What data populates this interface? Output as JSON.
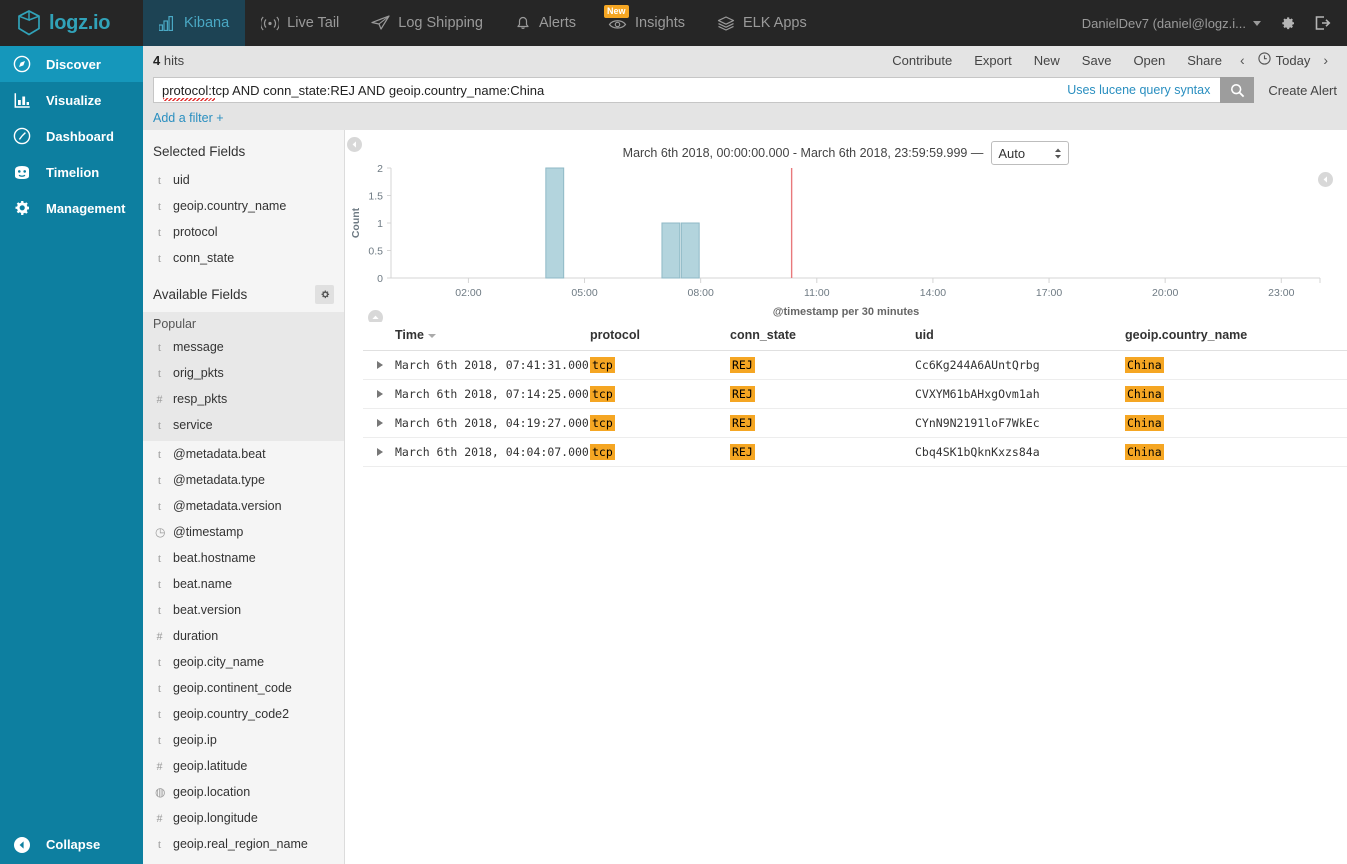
{
  "brand": {
    "name": "logz.io"
  },
  "topnav": {
    "items": [
      {
        "label": "Kibana",
        "icon": "bar-chart-icon",
        "active": true
      },
      {
        "label": "Live Tail",
        "icon": "broadcast-icon",
        "active": false
      },
      {
        "label": "Log Shipping",
        "icon": "paper-plane-icon",
        "active": false
      },
      {
        "label": "Alerts",
        "icon": "bell-icon",
        "active": false
      },
      {
        "label": "Insights",
        "icon": "eye-icon",
        "active": false,
        "badge": "New"
      },
      {
        "label": "ELK Apps",
        "icon": "layers-icon",
        "active": false
      }
    ],
    "user": "DanielDev7 (daniel@logz.i...",
    "settings_icon": "gear-icon",
    "logout_icon": "logout-icon"
  },
  "leftnav": {
    "items": [
      {
        "label": "Discover",
        "icon": "compass-icon",
        "active": true
      },
      {
        "label": "Visualize",
        "icon": "bar-chart-icon",
        "active": false
      },
      {
        "label": "Dashboard",
        "icon": "dashboard-icon",
        "active": false
      },
      {
        "label": "Timelion",
        "icon": "timelion-icon",
        "active": false
      },
      {
        "label": "Management",
        "icon": "gear-icon",
        "active": false
      }
    ],
    "collapse_label": "Collapse"
  },
  "toolbar": {
    "hits_count": "4",
    "hits_label": "hits",
    "links": [
      "Contribute",
      "Export",
      "New",
      "Save",
      "Open",
      "Share"
    ],
    "prev_arrow": "‹",
    "next_arrow": "›",
    "time_label": "Today",
    "clock_icon": "clock-icon"
  },
  "search": {
    "query": "protocol:tcp AND conn_state:REJ AND geoip.country_name:China",
    "hint": "Uses lucene query syntax",
    "search_icon": "search-icon",
    "create_alert": "Create Alert",
    "add_filter": "Add a filter +"
  },
  "fields": {
    "selected_title": "Selected Fields",
    "selected": [
      {
        "type": "t",
        "name": "uid"
      },
      {
        "type": "t",
        "name": "geoip.country_name"
      },
      {
        "type": "t",
        "name": "protocol"
      },
      {
        "type": "t",
        "name": "conn_state"
      }
    ],
    "available_title": "Available Fields",
    "settings_icon": "gear-icon",
    "popular_title": "Popular",
    "popular": [
      {
        "type": "t",
        "name": "message"
      },
      {
        "type": "t",
        "name": "orig_pkts"
      },
      {
        "type": "#",
        "name": "resp_pkts"
      },
      {
        "type": "t",
        "name": "service"
      }
    ],
    "available": [
      {
        "type": "t",
        "name": "@metadata.beat"
      },
      {
        "type": "t",
        "name": "@metadata.type"
      },
      {
        "type": "t",
        "name": "@metadata.version"
      },
      {
        "type": "◷",
        "name": "@timestamp"
      },
      {
        "type": "t",
        "name": "beat.hostname"
      },
      {
        "type": "t",
        "name": "beat.name"
      },
      {
        "type": "t",
        "name": "beat.version"
      },
      {
        "type": "#",
        "name": "duration"
      },
      {
        "type": "t",
        "name": "geoip.city_name"
      },
      {
        "type": "t",
        "name": "geoip.continent_code"
      },
      {
        "type": "t",
        "name": "geoip.country_code2"
      },
      {
        "type": "t",
        "name": "geoip.ip"
      },
      {
        "type": "#",
        "name": "geoip.latitude"
      },
      {
        "type": "◍",
        "name": "geoip.location"
      },
      {
        "type": "#",
        "name": "geoip.longitude"
      },
      {
        "type": "t",
        "name": "geoip.real_region_name"
      }
    ]
  },
  "chart_header": {
    "range": "March 6th 2018, 00:00:00.000 - March 6th 2018, 23:59:59.999 —",
    "interval": "Auto"
  },
  "chart_data": {
    "type": "bar",
    "title": "",
    "xlabel": "@timestamp per 30 minutes",
    "ylabel": "Count",
    "ylim": [
      0,
      2
    ],
    "yticks": [
      0,
      0.5,
      1,
      1.5,
      2
    ],
    "ytick_labels": [
      "0",
      "0.5",
      "1",
      "1.5",
      "2"
    ],
    "xtick_labels": [
      "02:00",
      "05:00",
      "08:00",
      "11:00",
      "14:00",
      "17:00",
      "20:00",
      "23:00"
    ],
    "xtick_hours": [
      2,
      5,
      8,
      11,
      14,
      17,
      20,
      23
    ],
    "x_domain_hours": [
      0,
      24
    ],
    "grid": false,
    "bar_color": "#b3d4dd",
    "bar_border_color": "#8fb9c6",
    "marker_color": "#e8797b",
    "marker_hour": 10.35,
    "bars": [
      {
        "hour": 4.0,
        "value": 2
      },
      {
        "hour": 7.0,
        "value": 1
      },
      {
        "hour": 7.5,
        "value": 1
      }
    ]
  },
  "table": {
    "columns": [
      "Time",
      "protocol",
      "conn_state",
      "uid",
      "geoip.country_name"
    ],
    "sort_column": "Time",
    "rows": [
      {
        "time": "March 6th 2018, 07:41:31.000",
        "protocol": "tcp",
        "conn_state": "REJ",
        "uid": "Cc6Kg244A6AUntQrbg",
        "country": "China"
      },
      {
        "time": "March 6th 2018, 07:14:25.000",
        "protocol": "tcp",
        "conn_state": "REJ",
        "uid": "CVXYM61bAHxgOvm1ah",
        "country": "China"
      },
      {
        "time": "March 6th 2018, 04:19:27.000",
        "protocol": "tcp",
        "conn_state": "REJ",
        "uid": "CYnN9N2191loF7WkEc",
        "country": "China"
      },
      {
        "time": "March 6th 2018, 04:04:07.000",
        "protocol": "tcp",
        "conn_state": "REJ",
        "uid": "Cbq4SK1bQknKxzs84a",
        "country": "China"
      }
    ]
  },
  "colors": {
    "brand_teal": "#31a2b8",
    "nav_blue": "#0d7fa0",
    "nav_active": "#1597bb",
    "topbar_dark": "#262626",
    "highlight_orange": "#f5a623",
    "link_blue": "#2a8fc0"
  }
}
